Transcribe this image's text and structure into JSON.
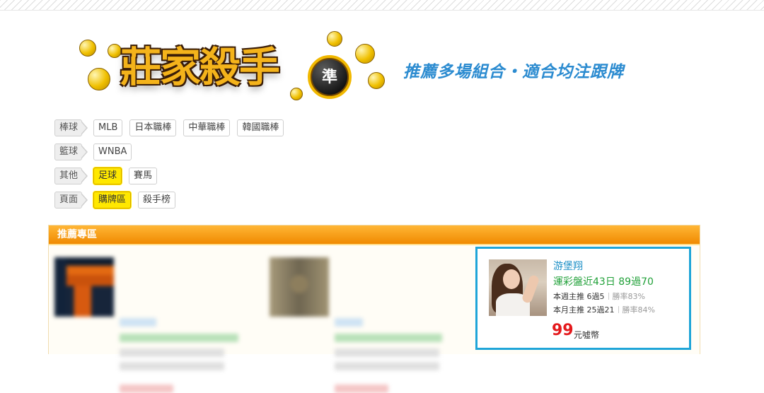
{
  "header": {
    "logo_text": "莊家殺手",
    "logo_badge": "準",
    "slogan": "推薦多場組合・適合均注跟牌"
  },
  "filters": [
    {
      "category": "棒球",
      "options": [
        {
          "label": "MLB",
          "active": false
        },
        {
          "label": "日本職棒",
          "active": false
        },
        {
          "label": "中華職棒",
          "active": false
        },
        {
          "label": "韓國職棒",
          "active": false
        }
      ]
    },
    {
      "category": "籃球",
      "options": [
        {
          "label": "WNBA",
          "active": false
        }
      ]
    },
    {
      "category": "其他",
      "options": [
        {
          "label": "足球",
          "active": true
        },
        {
          "label": "賽馬",
          "active": false
        }
      ]
    },
    {
      "category": "頁面",
      "options": [
        {
          "label": "購牌區",
          "active": true
        },
        {
          "label": "殺手榜",
          "active": false
        }
      ]
    }
  ],
  "panel": {
    "title": "推薦專區"
  },
  "featured": {
    "name": "游堡翔",
    "record": "運彩盤近43日 89過70",
    "weekly": "本週主推 6過5",
    "weekly_rate": "勝率83%",
    "monthly": "本月主推 25過21",
    "monthly_rate": "勝率84%",
    "price": "99",
    "unit": "元噓幣"
  },
  "colors": {
    "accent_orange": "#f08a00",
    "active_yellow": "#ffe800",
    "highlight_border": "#1fa5d8",
    "record_green": "#22a13a",
    "price_red": "#e4191c"
  }
}
